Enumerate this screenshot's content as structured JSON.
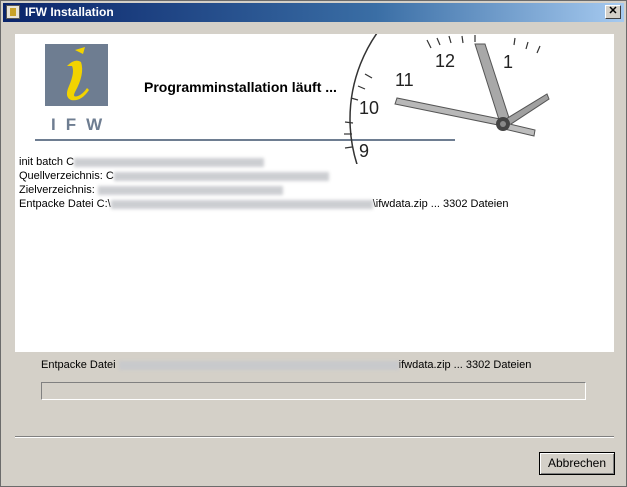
{
  "window": {
    "title": "IFW Installation",
    "app_icon": "ifw-app-icon",
    "close_glyph": "✕"
  },
  "banner": {
    "logo_letter": "i",
    "logo_text": "IFW",
    "headline": "Programminstallation läuft ...",
    "clock_numbers": [
      "12",
      "11",
      "10",
      "9",
      "1"
    ]
  },
  "log": {
    "line1_prefix": "init batch C",
    "line2_prefix": "Quellverzeichnis: C",
    "line3_prefix": "Zielverzeichnis: ",
    "line4_prefix": "Entpacke Datei C:\\",
    "line4_suffix": "\\ifwdata.zip ... 3302 Dateien"
  },
  "status": {
    "prefix": "Entpacke Datei ",
    "suffix": "ifwdata.zip ... 3302 Dateien"
  },
  "progress": {
    "value": 0
  },
  "buttons": {
    "cancel": "Abbrechen"
  },
  "colors": {
    "titlebar_start": "#0a246a",
    "logo_blue": "#6e7d91",
    "logo_accent": "#f2d300"
  }
}
